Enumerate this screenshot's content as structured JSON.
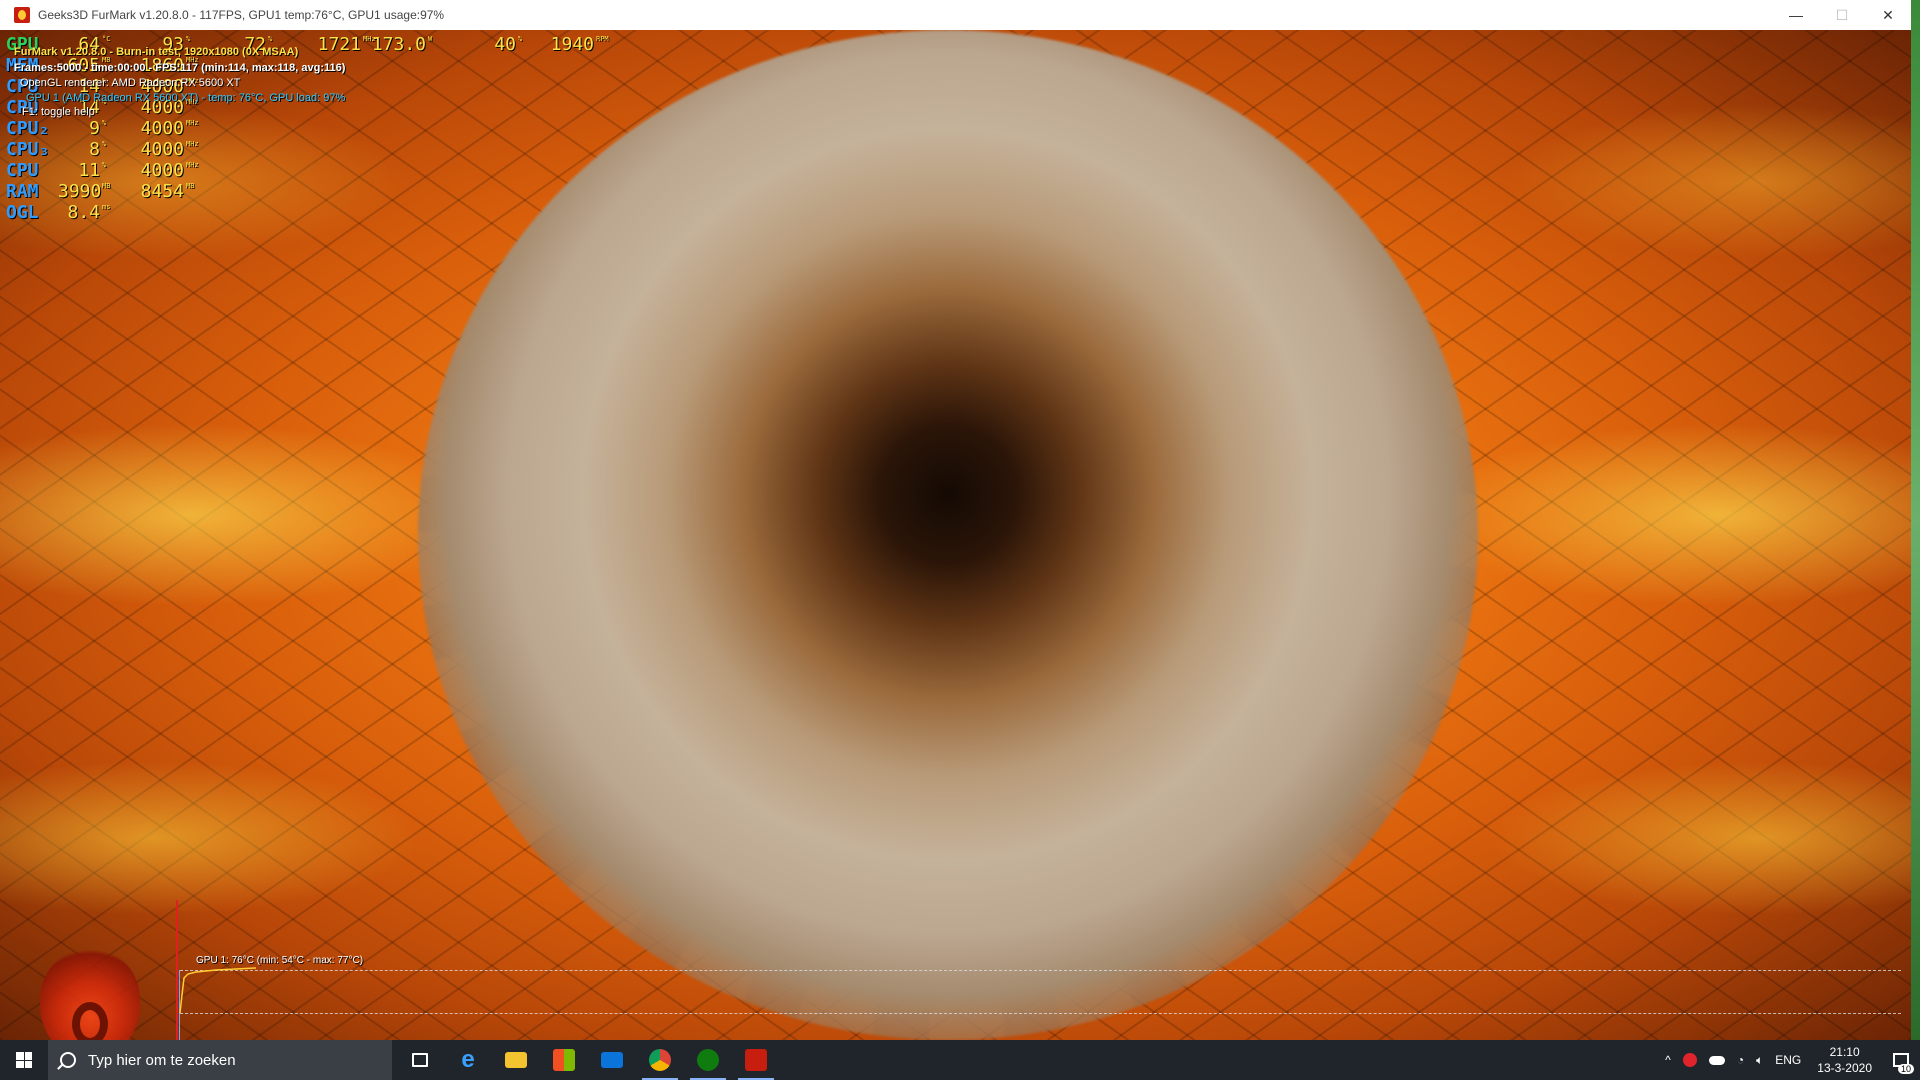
{
  "window": {
    "title": "Geeks3D FurMark v1.20.8.0 - 117FPS, GPU1 temp:76°C, GPU1 usage:97%",
    "minimize": "—",
    "maximize": "☐",
    "close": "✕"
  },
  "osd": {
    "rows": [
      {
        "label": "GPU",
        "v1": "64",
        "u1": "°C",
        "v2": "93",
        "u2": "%",
        "v3": "72",
        "u3": "%",
        "v4": "1721",
        "u4": "MHz",
        "v5": "173.0",
        "u5": "W",
        "v6": "40",
        "u6": "%",
        "v7": "1940",
        "u7": "RPM"
      },
      {
        "label": "MEM",
        "v1": "605",
        "u1": "MB",
        "v2": "1860",
        "u2": "MHz"
      },
      {
        "label": "CPU",
        "v1": "14",
        "u1": "%",
        "v2": "4000",
        "u2": "MHz"
      },
      {
        "label": "CPU",
        "v1": "14",
        "u1": "%",
        "v2": "4000",
        "u2": "MHz"
      },
      {
        "label": "CPU₂",
        "v1": "9",
        "u1": "%",
        "v2": "4000",
        "u2": "MHz"
      },
      {
        "label": "CPU₃",
        "v1": "8",
        "u1": "%",
        "v2": "4000",
        "u2": "MHz"
      },
      {
        "label": "CPU",
        "v1": "11",
        "u1": "%",
        "v2": "4000",
        "u2": "MHz"
      },
      {
        "label": "RAM",
        "v1": "3990",
        "u1": "MB",
        "v2": "8454",
        "u2": "MB"
      },
      {
        "label": "OGL",
        "v1": "8.4",
        "u1": "ms"
      }
    ],
    "bench_lines": [
      "FurMark v1.20.8.0 - Burn-in test, 1920x1080 (0X MSAA)",
      "Frames:5000 - time:00:00 - FPS:117 (min:114, max:118, avg:116)",
      "OpenGL renderer: AMD Radeon RX 5600 XT",
      "GPU 1 (AMD Radeon RX 5600 XT) - temp: 76°C, GPU load: 97%",
      "F1: toggle help"
    ]
  },
  "graph": {
    "label": "GPU 1: 76°C (min: 54°C - max: 77°C)"
  },
  "taskbar": {
    "search_placeholder": "Typ hier om te zoeken",
    "lang": "ENG",
    "time": "21:10",
    "date": "13-3-2020",
    "notif_count": "10",
    "tray_chevron": "^"
  },
  "colors": {
    "osd_label": "#2f9bff",
    "osd_value": "#ffe14a",
    "taskbar_bg": "#20252b"
  }
}
